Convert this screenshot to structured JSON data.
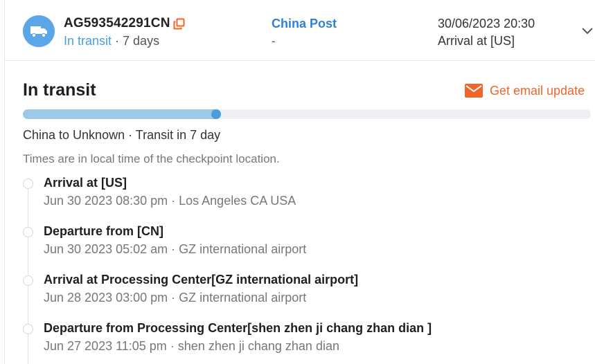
{
  "header": {
    "tracking_number": "AG593542291CN",
    "status": "In transit",
    "status_separator": " · ",
    "duration": "7 days",
    "carrier": "China Post",
    "carrier_sub": "-",
    "latest_time": "30/06/2023 20:30",
    "latest_event": "Arrival at [US]",
    "icons": {
      "badge": "truck-icon",
      "copy": "copy-icon",
      "expand": "chevron-down-icon"
    }
  },
  "detail": {
    "title": "In transit",
    "email_update_label": "Get email update",
    "progress_fraction": 0.34,
    "route_summary": "China to Unknown · Transit in 7 day",
    "tz_note": "Times are in local time of the checkpoint location."
  },
  "events": [
    {
      "title": "Arrival at [US]",
      "meta": "Jun 30 2023 08:30 pm · Los Angeles CA USA"
    },
    {
      "title": "Departure from [CN]",
      "meta": "Jun 30 2023 05:02 am · GZ international airport"
    },
    {
      "title": "Arrival at Processing Center[GZ international airport]",
      "meta": "Jun 28 2023 03:00 pm · GZ international airport"
    },
    {
      "title": "Departure from Processing Center[shen zhen ji chang zhan dian ]",
      "meta": "Jun 27 2023 11:05 pm · shen zhen ji chang zhan dian"
    }
  ],
  "colors": {
    "accent_blue": "#4a9ee0",
    "carrier_blue": "#2f7fd9",
    "email_orange": "#f0642a",
    "progress_fill": "#9cc8ea"
  }
}
